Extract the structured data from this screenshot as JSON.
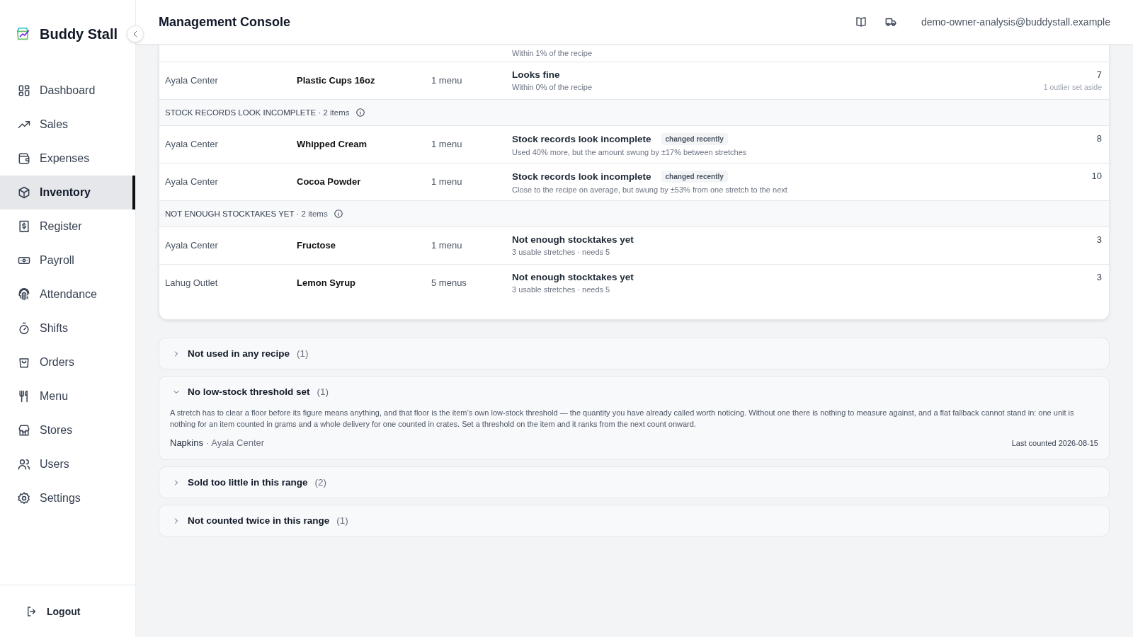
{
  "sidebar": {
    "brand": "Buddy Stall",
    "items": [
      {
        "label": "Dashboard",
        "selected": false
      },
      {
        "label": "Sales",
        "selected": false
      },
      {
        "label": "Expenses",
        "selected": false
      },
      {
        "label": "Inventory",
        "selected": true
      },
      {
        "label": "Register",
        "selected": false
      },
      {
        "label": "Payroll",
        "selected": false
      },
      {
        "label": "Attendance",
        "selected": false
      },
      {
        "label": "Shifts",
        "selected": false
      },
      {
        "label": "Orders",
        "selected": false
      },
      {
        "label": "Menu",
        "selected": false
      },
      {
        "label": "Stores",
        "selected": false
      },
      {
        "label": "Users",
        "selected": false
      },
      {
        "label": "Settings",
        "selected": false
      }
    ],
    "logout": "Logout"
  },
  "header": {
    "title": "Management Console",
    "user": "demo-owner-analysis@buddystall.example"
  },
  "table": {
    "partial_row": {
      "note": "Within 1% of the recipe"
    },
    "rows": [
      {
        "kind": "item",
        "store": "Ayala Center",
        "item": "Plastic Cups 16oz",
        "menus": "1 menu",
        "status": "Looks fine",
        "note": "Within 0% of the recipe",
        "value": "7",
        "value_note": "1 outlier set aside"
      },
      {
        "kind": "group",
        "title": "STOCK RECORDS LOOK INCOMPLETE",
        "count": "· 2 items"
      },
      {
        "kind": "item",
        "store": "Ayala Center",
        "item": "Whipped Cream",
        "menus": "1 menu",
        "status": "Stock records look incomplete",
        "badge": "changed recently",
        "note": "Used 40% more, but the amount swung by ±17% between stretches",
        "value": "8"
      },
      {
        "kind": "item",
        "store": "Ayala Center",
        "item": "Cocoa Powder",
        "menus": "1 menu",
        "status": "Stock records look incomplete",
        "badge": "changed recently",
        "note": "Close to the recipe on average, but swung by ±53% from one stretch to the next",
        "value": "10"
      },
      {
        "kind": "group",
        "title": "NOT ENOUGH STOCKTAKES YET",
        "count": "· 2 items"
      },
      {
        "kind": "item",
        "store": "Ayala Center",
        "item": "Fructose",
        "menus": "1 menu",
        "status": "Not enough stocktakes yet",
        "note": "3 usable stretches · needs 5",
        "value": "3"
      },
      {
        "kind": "item",
        "store": "Lahug Outlet",
        "item": "Lemon Syrup",
        "menus": "5 menus",
        "status": "Not enough stocktakes yet",
        "note": "3 usable stretches · needs 5",
        "value": "3"
      }
    ]
  },
  "sections": [
    {
      "title": "Not used in any recipe",
      "count": "(1)",
      "expanded": false
    },
    {
      "title": "No low-stock threshold set",
      "count": "(1)",
      "expanded": true,
      "text": "A stretch has to clear a floor before its figure means anything, and that floor is the item’s own low-stock threshold — the quantity you have already called worth noticing. Without one there is nothing to measure against, and a flat fallback cannot stand in: one unit is nothing for an item counted in grams and a whole delivery for one counted in crates. Set a threshold on the item and it ranks from the next count onward.",
      "entries": [
        {
          "item": "Napkins",
          "store": "· Ayala Center",
          "last_counted": "Last counted 2026-08-15"
        }
      ]
    },
    {
      "title": "Sold too little in this range",
      "count": "(2)",
      "expanded": false
    },
    {
      "title": "Not counted twice in this range",
      "count": "(1)",
      "expanded": false
    }
  ]
}
